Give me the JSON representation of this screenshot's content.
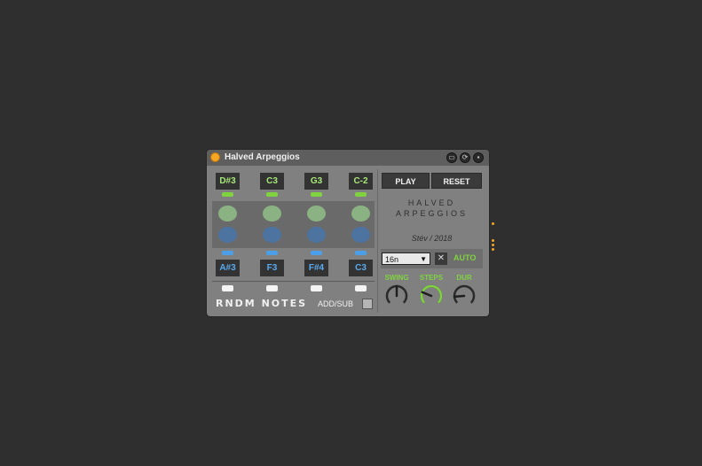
{
  "device": {
    "title": "Halved Arpeggios",
    "header_icons": [
      "collapse-icon",
      "link-icon",
      "save-icon"
    ]
  },
  "top_notes": [
    "D#3",
    "C3",
    "G3",
    "C-2"
  ],
  "bottom_notes": [
    "A#3",
    "F3",
    "F#4",
    "C3"
  ],
  "rndm_label": "RNDM NOTES",
  "addsub_label": "ADD/SUB",
  "play_label": "PLAY",
  "reset_label": "RESET",
  "logo_line1": "HALVED",
  "logo_line2": "ARPEGGIOS",
  "author": "Stév / 2018",
  "rate": {
    "value": "16n",
    "arrow": "▼"
  },
  "x_label": "✕",
  "auto_label": "AUTO",
  "knobs": [
    {
      "label": "SWING",
      "value": 0.5,
      "active": false
    },
    {
      "label": "STEPS",
      "value": 0.25,
      "active": true
    },
    {
      "label": "DUR",
      "value": 0.15,
      "active": false
    }
  ],
  "colors": {
    "accent_green": "#7ed33f",
    "note_blue": "#59aaf0",
    "power_orange": "#f5a623"
  }
}
